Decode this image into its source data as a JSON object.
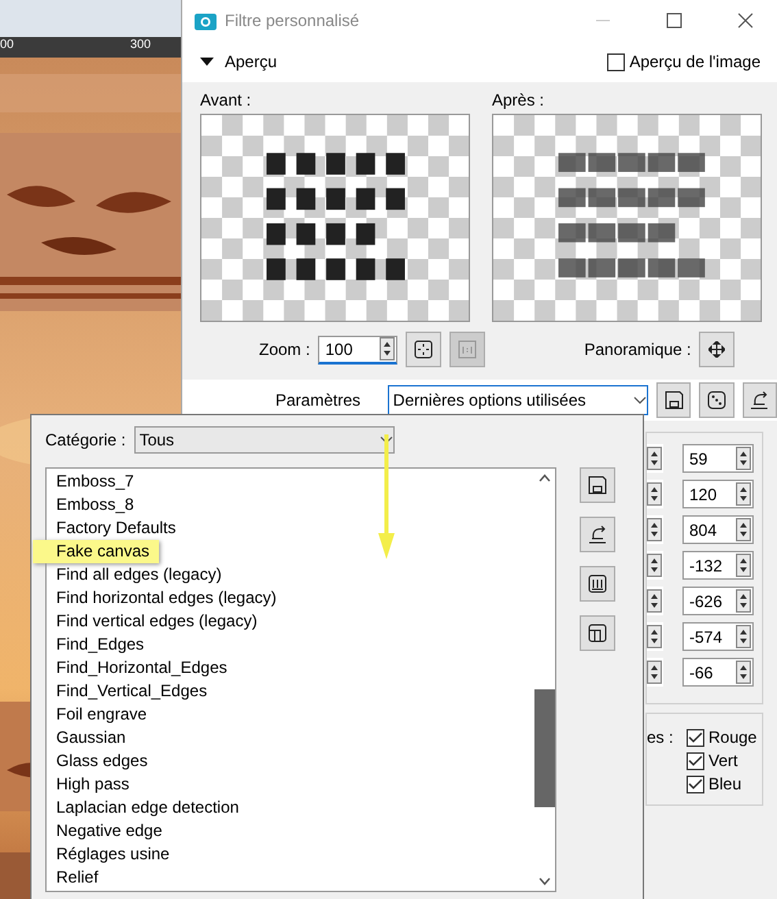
{
  "background_app": {
    "ruler_labels": [
      "00",
      "300"
    ]
  },
  "dialog": {
    "title": "Filtre personnalisé",
    "preview_section": {
      "label": "Aperçu",
      "expanded": true
    },
    "image_preview": {
      "label": "Aperçu de l'image",
      "checked": false
    },
    "before_label": "Avant :",
    "after_label": "Après :",
    "zoom": {
      "label": "Zoom :",
      "value": "100"
    },
    "pan": {
      "label": "Panoramique :"
    },
    "parameters": {
      "label": "Paramètres",
      "value": "Dernières options utilisées"
    },
    "values": [
      "59",
      "120",
      "804",
      "-132",
      "-626",
      "-574",
      "-66"
    ],
    "channels": {
      "label": "es :",
      "items": [
        {
          "label": "Rouge",
          "checked": true
        },
        {
          "label": "Vert",
          "checked": true
        },
        {
          "label": "Bleu",
          "checked": true
        }
      ]
    }
  },
  "category_popup": {
    "label": "Catégorie :",
    "value": "Tous",
    "items": [
      {
        "label": "Emboss_7",
        "highlighted": false
      },
      {
        "label": "Emboss_8",
        "highlighted": false
      },
      {
        "label": "Factory Defaults",
        "highlighted": false
      },
      {
        "label": "Fake canvas",
        "highlighted": true
      },
      {
        "label": "Find all edges (legacy)",
        "highlighted": false
      },
      {
        "label": "Find horizontal edges (legacy)",
        "highlighted": false
      },
      {
        "label": "Find vertical edges (legacy)",
        "highlighted": false
      },
      {
        "label": "Find_Edges",
        "highlighted": false
      },
      {
        "label": "Find_Horizontal_Edges",
        "highlighted": false
      },
      {
        "label": "Find_Vertical_Edges",
        "highlighted": false
      },
      {
        "label": "Foil engrave",
        "highlighted": false
      },
      {
        "label": "Gaussian",
        "highlighted": false
      },
      {
        "label": "Glass edges",
        "highlighted": false
      },
      {
        "label": "High pass",
        "highlighted": false
      },
      {
        "label": "Laplacian edge detection",
        "highlighted": false
      },
      {
        "label": "Negative edge",
        "highlighted": false
      },
      {
        "label": "Réglages usine",
        "highlighted": false
      },
      {
        "label": "Relief",
        "highlighted": false
      }
    ]
  }
}
